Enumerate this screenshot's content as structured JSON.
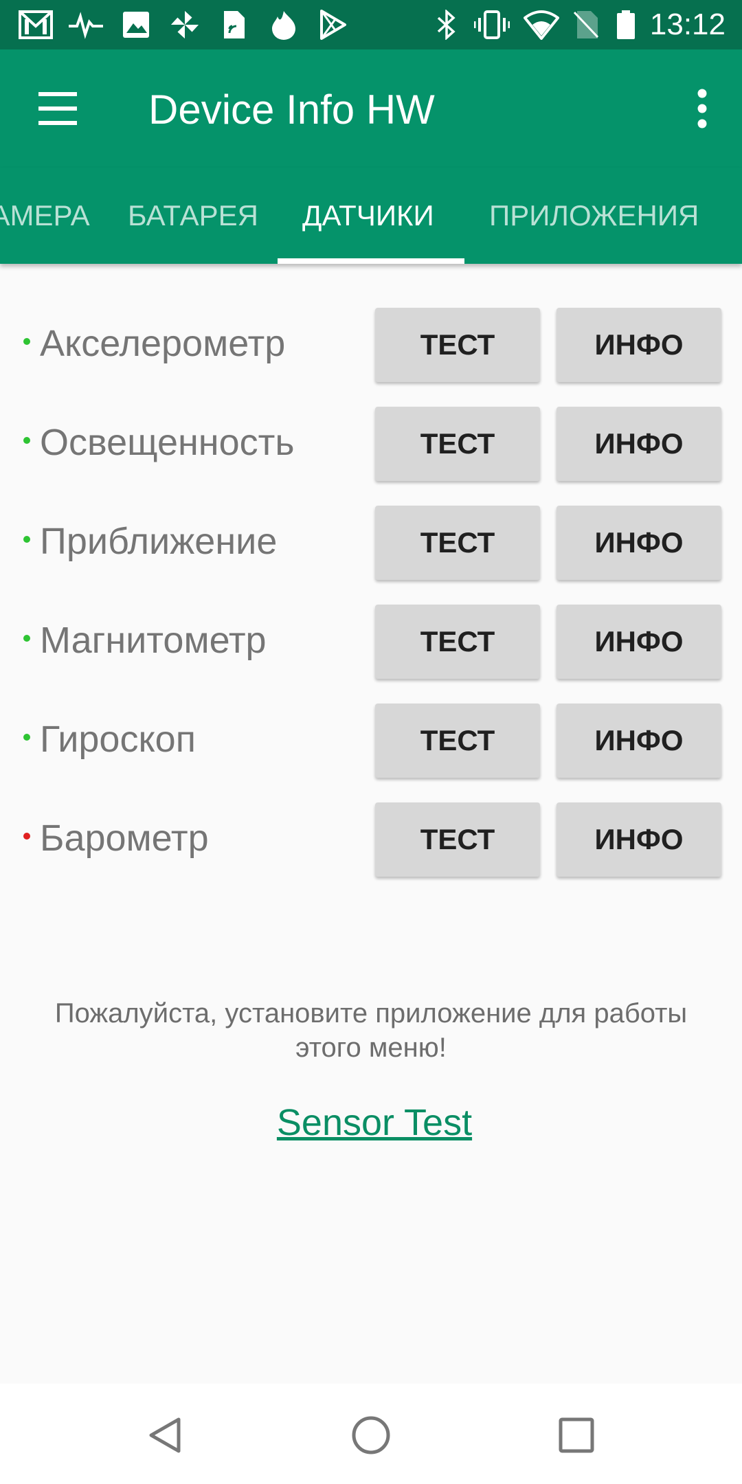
{
  "status_bar": {
    "time": "13:12",
    "left_icons": [
      "gmail-icon",
      "activity-icon",
      "gallery-icon",
      "pinwheel-icon",
      "sim-card-icon",
      "flame-icon",
      "play-store-icon"
    ],
    "right_icons": [
      "bluetooth-icon",
      "vibrate-icon",
      "wifi-icon",
      "no-sim-icon",
      "battery-icon"
    ]
  },
  "toolbar": {
    "title": "Device Info HW",
    "menu_icon": "hamburger-menu-icon",
    "overflow_icon": "more-vert-icon"
  },
  "tabs": [
    {
      "label": "КАМЕРА",
      "active": false
    },
    {
      "label": "БАТАРЕЯ",
      "active": false
    },
    {
      "label": "ДАТЧИКИ",
      "active": true
    },
    {
      "label": "ПРИЛОЖЕНИЯ",
      "active": false
    }
  ],
  "sensors": [
    {
      "name": "Акселерометр",
      "status_color": "#2ec433",
      "test_label": "ТЕСТ",
      "info_label": "ИНФО"
    },
    {
      "name": "Освещенность",
      "status_color": "#2ec433",
      "test_label": "ТЕСТ",
      "info_label": "ИНФО"
    },
    {
      "name": "Приближение",
      "status_color": "#2ec433",
      "test_label": "ТЕСТ",
      "info_label": "ИНФО"
    },
    {
      "name": "Магнитометр",
      "status_color": "#2ec433",
      "test_label": "ТЕСТ",
      "info_label": "ИНФО"
    },
    {
      "name": "Гироскоп",
      "status_color": "#2ec433",
      "test_label": "ТЕСТ",
      "info_label": "ИНФО"
    },
    {
      "name": "Барометр",
      "status_color": "#e02020",
      "test_label": "ТЕСТ",
      "info_label": "ИНФО"
    }
  ],
  "message": {
    "text": "Пожалуйста, установите приложение для работы этого меню!",
    "link": "Sensor Test "
  },
  "nav_bar": {
    "back_icon": "back-triangle-icon",
    "home_icon": "home-circle-icon",
    "recents_icon": "recents-square-icon"
  },
  "colors": {
    "primary": "#05936a",
    "primary_dark": "#06704f",
    "accent_link": "#0a8e64",
    "button_bg": "#d7d7d7"
  }
}
